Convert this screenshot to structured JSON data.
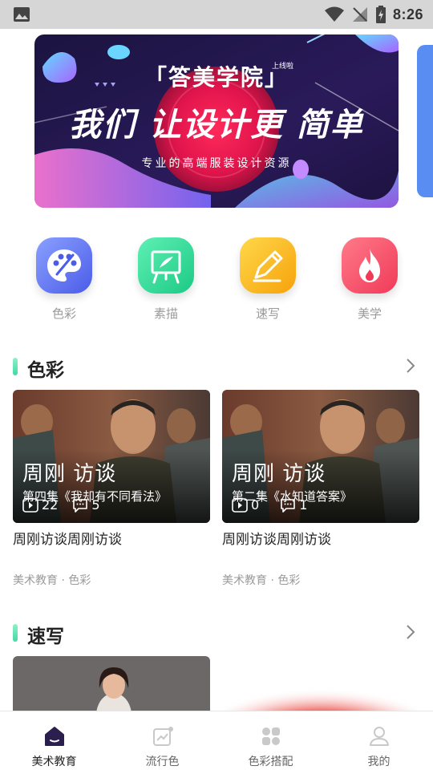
{
  "status_bar": {
    "time": "8:26"
  },
  "banner": {
    "top_text": "「答美学院」",
    "tag": "上线啦",
    "headline": "我们 让设计更 简单",
    "subtitle": "专业的高端服装设计资源"
  },
  "categories": [
    {
      "label": "色彩",
      "icon": "palette-icon",
      "color": "#5b6ef0"
    },
    {
      "label": "素描",
      "icon": "easel-icon",
      "color": "#2fd896"
    },
    {
      "label": "速写",
      "icon": "pencil-icon",
      "color": "#fbbf1f"
    },
    {
      "label": "美学",
      "icon": "flame-icon",
      "color": "#f5506a"
    }
  ],
  "sections": [
    {
      "title": "色彩",
      "cards": [
        {
          "overlay_title": "周刚 访谈",
          "episode": "第四集《我却有不同看法》",
          "plays": "22",
          "comments": "5",
          "name": "周刚访谈周刚访谈",
          "meta": "美术教育 · 色彩"
        },
        {
          "overlay_title": "周刚 访谈",
          "episode": "第二集《水知道答案》",
          "plays": "0",
          "comments": "1",
          "name": "周刚访谈周刚访谈",
          "meta": "美术教育 · 色彩"
        }
      ]
    },
    {
      "title": "速写",
      "cards": []
    }
  ],
  "tab_bar": [
    {
      "label": "美术教育",
      "icon": "house-icon",
      "active": true
    },
    {
      "label": "流行色",
      "icon": "trend-chart-icon",
      "active": false
    },
    {
      "label": "色彩搭配",
      "icon": "grid-dots-icon",
      "active": false
    },
    {
      "label": "我的",
      "icon": "user-icon",
      "active": false
    }
  ],
  "colors": {
    "accent": "#2b1f4d",
    "section_bar": "#42d9a4",
    "muted_text": "#9a9a9a"
  }
}
